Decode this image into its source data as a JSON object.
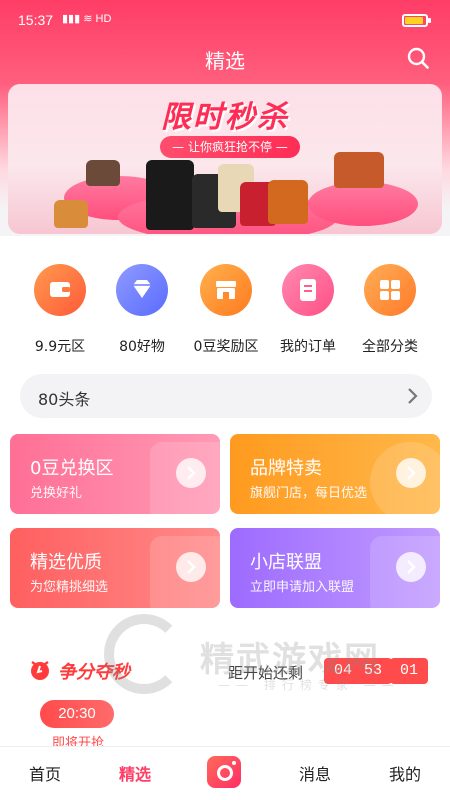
{
  "status_bar": {
    "time": "15:37",
    "signal": "HD"
  },
  "header": {
    "title": "精选"
  },
  "banner": {
    "title": "限时秒杀",
    "subtitle": "— 让你疯狂抢不停 —"
  },
  "categories": [
    {
      "label": "9.9元区",
      "icon": "wallet-icon",
      "color": "#ff6a3d"
    },
    {
      "label": "80好物",
      "icon": "diamond-icon",
      "color": "#6b7bff"
    },
    {
      "label": "0豆奖励区",
      "icon": "shop-icon",
      "color": "#ff8a2d"
    },
    {
      "label": "我的订单",
      "icon": "order-icon",
      "color": "#ff5e8e"
    },
    {
      "label": "全部分类",
      "icon": "grid-icon",
      "color": "#ff8c3a"
    }
  ],
  "headline": {
    "label": "80头条"
  },
  "cards": [
    {
      "title": "0豆兑换区",
      "subtitle": "兑换好礼",
      "color_from": "#ff6f96",
      "color_to": "#ff9ab5"
    },
    {
      "title": "品牌特卖",
      "subtitle": "旗舰门店，每日优选",
      "color_from": "#ff9a1f",
      "color_to": "#ffb84a"
    },
    {
      "title": "精选优质",
      "subtitle": "为您精挑细选",
      "color_from": "#ff5f5f",
      "color_to": "#ff8b8b"
    },
    {
      "title": "小店联盟",
      "subtitle": "立即申请加入联盟",
      "color_from": "#9d6bff",
      "color_to": "#c19bff"
    }
  ],
  "flash_sale": {
    "title": "争分夺秒",
    "countdown_label": "距开始还剩",
    "hours": "04",
    "minutes": "53",
    "seconds": "01",
    "slot_time": "20:30",
    "slot_status": "即将开抢"
  },
  "tabbar": {
    "home": "首页",
    "featured": "精选",
    "messages": "消息",
    "mine": "我的"
  },
  "colors": {
    "accent": "#ff3d66",
    "countdown": "#ff4b4b"
  }
}
